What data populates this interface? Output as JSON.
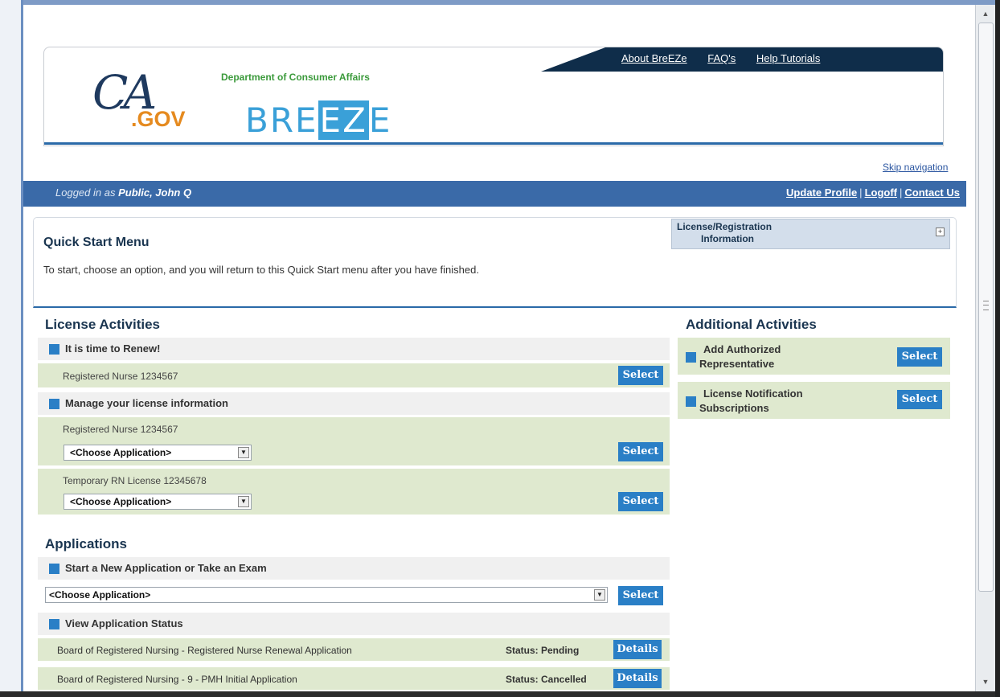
{
  "header": {
    "top_links": [
      "About BreEZe",
      "FAQ's",
      "Help Tutorials"
    ],
    "logo_ca": "CA",
    "logo_gov": ".GOV",
    "department": "Department of Consumer Affairs",
    "breeze_left": "BRE",
    "breeze_mid": "EZ",
    "breeze_right": "E"
  },
  "skip_nav": "Skip navigation",
  "user_bar": {
    "logged_prefix": "Logged in as ",
    "user_name": "Public, John Q",
    "update_profile": "Update Profile",
    "logoff": "Logoff",
    "contact_us": "Contact Us",
    "separator": "|"
  },
  "quick_start": {
    "title": "Quick Start Menu",
    "description": "To start, choose an option, and you will return to this Quick Start menu after you have finished.",
    "license_reg_line1": "License/Registration",
    "license_reg_line2": "Information",
    "expand_symbol": "+"
  },
  "license_activities": {
    "title": "License Activities",
    "renew_heading": "It is time to Renew!",
    "renew_row": "Registered Nurse  1234567",
    "manage_heading": "Manage your license information",
    "licenses": [
      {
        "label": "Registered Nurse  1234567",
        "dropdown": "<Choose Application>"
      },
      {
        "label": "Temporary RN License  12345678",
        "dropdown": "<Choose Application>"
      }
    ]
  },
  "applications": {
    "title": "Applications",
    "new_heading": "Start a New Application or Take an Exam",
    "new_dropdown": "<Choose Application>",
    "status_heading": "View Application Status",
    "status_rows": [
      {
        "label": "Board of Registered Nursing - Registered Nurse Renewal Application",
        "status": "Status: Pending",
        "button": "Details"
      },
      {
        "label": "Board of Registered Nursing - 9 - PMH Initial Application",
        "status": "Status: Cancelled",
        "button": "Details"
      }
    ]
  },
  "additional": {
    "title": "Additional Activities",
    "items": [
      {
        "line1": "Add Authorized",
        "line2": "Representative"
      },
      {
        "line1": "License Notification",
        "line2": "Subscriptions"
      }
    ]
  },
  "buttons": {
    "select": "Select"
  },
  "dropdown_arrow": "▼",
  "scroll_up": "▲",
  "scroll_down": "▼",
  "colors": {
    "accent_blue": "#2a7fc6",
    "bar_blue": "#3a6aa8",
    "row_green": "#dfe9cf",
    "banner_dark": "#0f2d4a",
    "gov_orange": "#e58a1f"
  }
}
